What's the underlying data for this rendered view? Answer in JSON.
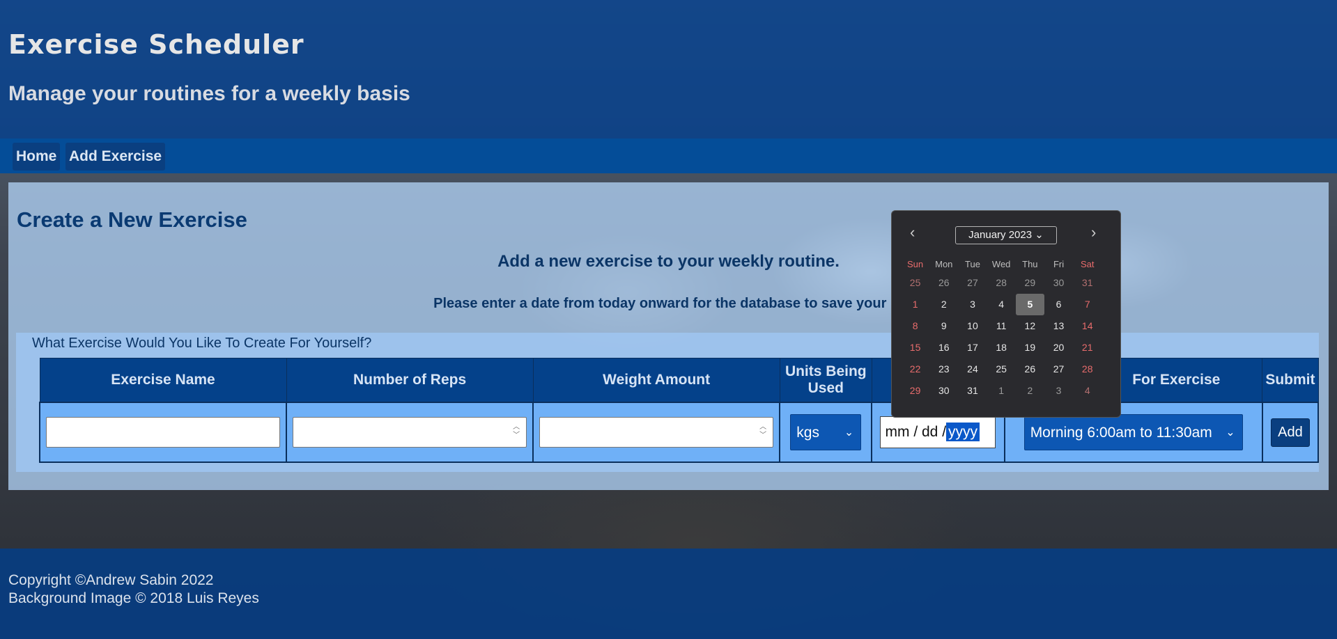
{
  "header": {
    "title": "Exercise Scheduler",
    "subtitle": "Manage your routines for a weekly basis"
  },
  "nav": {
    "home": "Home",
    "add_exercise": "Add Exercise"
  },
  "main": {
    "title": "Create a New Exercise",
    "lead": "Add a new exercise to your weekly routine.",
    "note": "Please enter a date from today onward for the database to save your re"
  },
  "form": {
    "legend": "What Exercise Would You Like To Create For Yourself?",
    "columns": [
      "Exercise Name",
      "Number of Reps",
      "Weight Amount",
      "Units Being Used",
      "",
      "For Exercise",
      "Submit"
    ],
    "units_selected": "kgs",
    "date_placeholder": {
      "mm": "mm",
      "dd": "dd",
      "yyyy": "yyyy"
    },
    "time_selected": "Morning 6:00am to 11:30am",
    "add_label": "Add"
  },
  "calendar": {
    "month_label": "January 2023",
    "weekday_headers": [
      "Sun",
      "Mon",
      "Tue",
      "Wed",
      "Thu",
      "Fri",
      "Sat"
    ],
    "weeks": [
      [
        "25",
        "26",
        "27",
        "28",
        "29",
        "30",
        "31"
      ],
      [
        "1",
        "2",
        "3",
        "4",
        "5",
        "6",
        "7"
      ],
      [
        "8",
        "9",
        "10",
        "11",
        "12",
        "13",
        "14"
      ],
      [
        "15",
        "16",
        "17",
        "18",
        "19",
        "20",
        "21"
      ],
      [
        "22",
        "23",
        "24",
        "25",
        "26",
        "27",
        "28"
      ],
      [
        "29",
        "30",
        "31",
        "1",
        "2",
        "3",
        "4"
      ]
    ],
    "selected_day": "5"
  },
  "footer": {
    "copyright": "Copyright ©Andrew Sabin 2022",
    "credit": "Background Image © 2018 Luis Reyes"
  }
}
